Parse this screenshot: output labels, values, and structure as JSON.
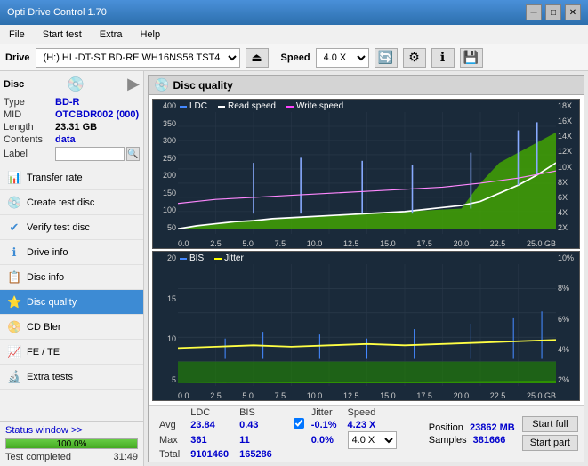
{
  "titlebar": {
    "title": "Opti Drive Control 1.70",
    "minimize": "─",
    "maximize": "□",
    "close": "✕"
  },
  "menubar": {
    "items": [
      "File",
      "Start test",
      "Extra",
      "Help"
    ]
  },
  "drivebar": {
    "label": "Drive",
    "drive_value": "(H:) HL-DT-ST BD-RE  WH16NS58 TST4",
    "speed_label": "Speed",
    "speed_value": "4.0 X"
  },
  "disc": {
    "title": "Disc",
    "type_label": "Type",
    "type_value": "BD-R",
    "mid_label": "MID",
    "mid_value": "OTCBDR002 (000)",
    "length_label": "Length",
    "length_value": "23.31 GB",
    "contents_label": "Contents",
    "contents_value": "data",
    "label_label": "Label"
  },
  "nav": {
    "items": [
      {
        "id": "transfer-rate",
        "label": "Transfer rate",
        "icon": "📊"
      },
      {
        "id": "create-test-disc",
        "label": "Create test disc",
        "icon": "💿"
      },
      {
        "id": "verify-test-disc",
        "label": "Verify test disc",
        "icon": "✔"
      },
      {
        "id": "drive-info",
        "label": "Drive info",
        "icon": "ℹ"
      },
      {
        "id": "disc-info",
        "label": "Disc info",
        "icon": "📋"
      },
      {
        "id": "disc-quality",
        "label": "Disc quality",
        "icon": "⭐",
        "active": true
      },
      {
        "id": "cd-bler",
        "label": "CD Bler",
        "icon": "📀"
      },
      {
        "id": "fe-te",
        "label": "FE / TE",
        "icon": "📈"
      },
      {
        "id": "extra-tests",
        "label": "Extra tests",
        "icon": "🔬"
      }
    ]
  },
  "status": {
    "link_text": "Status window >>",
    "completed_text": "Test completed",
    "progress": 100,
    "progress_text": "100.0%",
    "time": "31:49"
  },
  "disc_quality": {
    "panel_title": "Disc quality",
    "legend": {
      "ldc_label": "LDC",
      "read_speed_label": "Read speed",
      "write_speed_label": "Write speed",
      "bis_label": "BIS",
      "jitter_label": "Jitter"
    },
    "chart1": {
      "y_left": [
        "400",
        "350",
        "300",
        "250",
        "200",
        "150",
        "100",
        "50"
      ],
      "y_right": [
        "18X",
        "16X",
        "14X",
        "12X",
        "10X",
        "8X",
        "6X",
        "4X",
        "2X"
      ],
      "x_labels": [
        "0.0",
        "2.5",
        "5.0",
        "7.5",
        "10.0",
        "12.5",
        "15.0",
        "17.5",
        "20.0",
        "22.5",
        "25.0 GB"
      ]
    },
    "chart2": {
      "y_left": [
        "20",
        "15",
        "10",
        "5"
      ],
      "y_right": [
        "10%",
        "8%",
        "6%",
        "4%",
        "2%"
      ],
      "x_labels": [
        "0.0",
        "2.5",
        "5.0",
        "7.5",
        "10.0",
        "12.5",
        "15.0",
        "17.5",
        "20.0",
        "22.5",
        "25.0 GB"
      ]
    },
    "stats": {
      "ldc_label": "LDC",
      "bis_label": "BIS",
      "jitter_label": "Jitter",
      "speed_label": "Speed",
      "avg_label": "Avg",
      "max_label": "Max",
      "total_label": "Total",
      "ldc_avg": "23.84",
      "ldc_max": "361",
      "ldc_total": "9101460",
      "bis_avg": "0.43",
      "bis_max": "11",
      "bis_total": "165286",
      "jitter_avg": "-0.1%",
      "jitter_max": "0.0%",
      "speed_val": "4.23 X",
      "position_label": "Position",
      "position_val": "23862 MB",
      "samples_label": "Samples",
      "samples_val": "381666",
      "speed_select": "4.0 X"
    },
    "buttons": {
      "start_full": "Start full",
      "start_part": "Start part"
    }
  }
}
